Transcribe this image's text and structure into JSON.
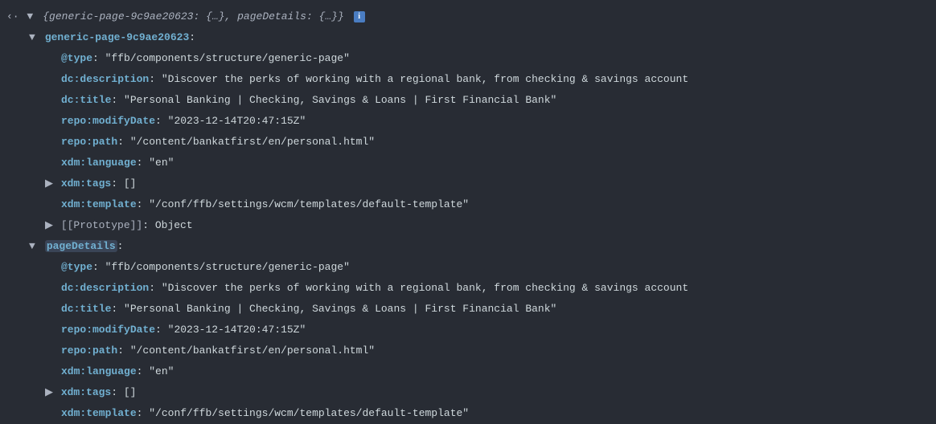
{
  "summary": {
    "back_glyph": "‹·",
    "arrow_expanded": "▼",
    "arrow_collapsed": "▶",
    "key1": "generic-page-9c9ae20623",
    "key2": "pageDetails",
    "ellipsis": "{…}",
    "info_glyph": "i"
  },
  "section1": {
    "name": "generic-page-9c9ae20623",
    "props": {
      "type_key": "@type",
      "type_val": "\"ffb/components/structure/generic-page\"",
      "desc_key": "dc:description",
      "desc_val": "\"Discover the perks of working with a regional bank, from checking & savings account",
      "title_key": "dc:title",
      "title_val": "\"Personal Banking | Checking, Savings & Loans | First Financial Bank\"",
      "modify_key": "repo:modifyDate",
      "modify_val": "\"2023-12-14T20:47:15Z\"",
      "path_key": "repo:path",
      "path_val": "\"/content/bankatfirst/en/personal.html\"",
      "lang_key": "xdm:language",
      "lang_val": "\"en\"",
      "tags_key": "xdm:tags",
      "tags_val": "[]",
      "template_key": "xdm:template",
      "template_val": "\"/conf/ffb/settings/wcm/templates/default-template\"",
      "proto_key": "[[Prototype]]",
      "proto_val": "Object"
    }
  },
  "section2": {
    "name": "pageDetails",
    "props": {
      "type_key": "@type",
      "type_val": "\"ffb/components/structure/generic-page\"",
      "desc_key": "dc:description",
      "desc_val": "\"Discover the perks of working with a regional bank, from checking & savings account",
      "title_key": "dc:title",
      "title_val": "\"Personal Banking | Checking, Savings & Loans | First Financial Bank\"",
      "modify_key": "repo:modifyDate",
      "modify_val": "\"2023-12-14T20:47:15Z\"",
      "path_key": "repo:path",
      "path_val": "\"/content/bankatfirst/en/personal.html\"",
      "lang_key": "xdm:language",
      "lang_val": "\"en\"",
      "tags_key": "xdm:tags",
      "tags_val": "[]",
      "template_key": "xdm:template",
      "template_val": "\"/conf/ffb/settings/wcm/templates/default-template\""
    }
  }
}
